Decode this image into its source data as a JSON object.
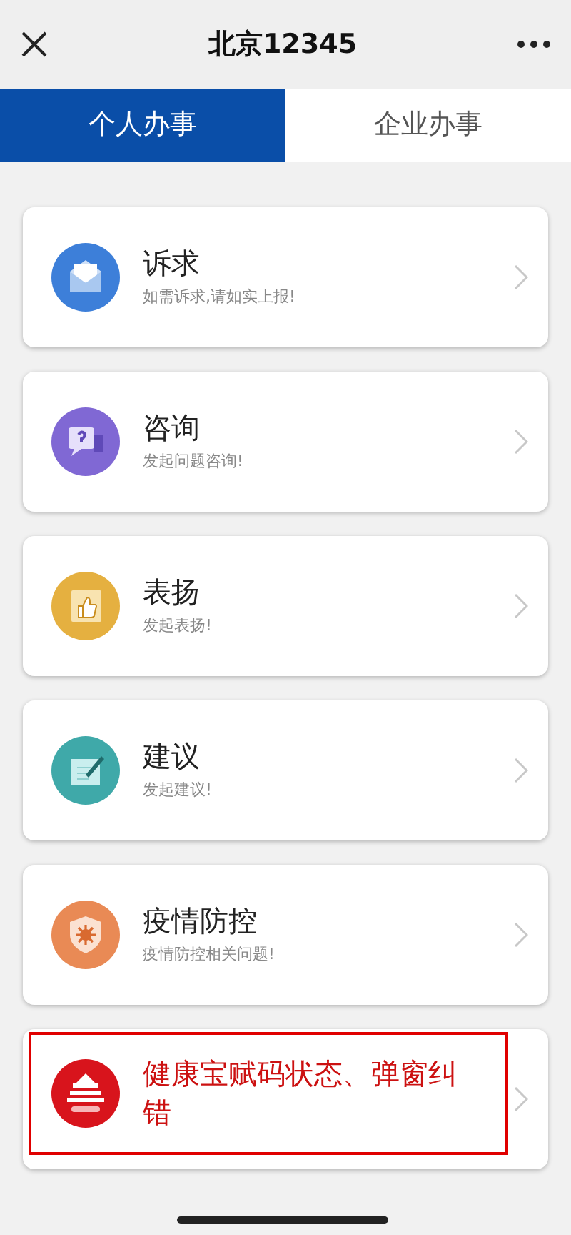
{
  "header": {
    "title": "北京12345"
  },
  "tabs": [
    {
      "label": "个人办事",
      "selected": true
    },
    {
      "label": "企业办事",
      "selected": false
    }
  ],
  "items": [
    {
      "kind": "envelope",
      "title": "诉求",
      "subtitle": "如需诉求,请如实上报!",
      "highlighted": false
    },
    {
      "kind": "question",
      "title": "咨询",
      "subtitle": "发起问题咨询!",
      "highlighted": false
    },
    {
      "kind": "praise",
      "title": "表扬",
      "subtitle": "发起表扬!",
      "highlighted": false
    },
    {
      "kind": "suggestion",
      "title": "建议",
      "subtitle": "发起建议!",
      "highlighted": false
    },
    {
      "kind": "epidemic",
      "title": "疫情防控",
      "subtitle": "疫情防控相关问题!",
      "highlighted": false
    },
    {
      "kind": "health",
      "title": "健康宝赋码状态、弹窗纠错",
      "highlighted": true
    }
  ]
}
